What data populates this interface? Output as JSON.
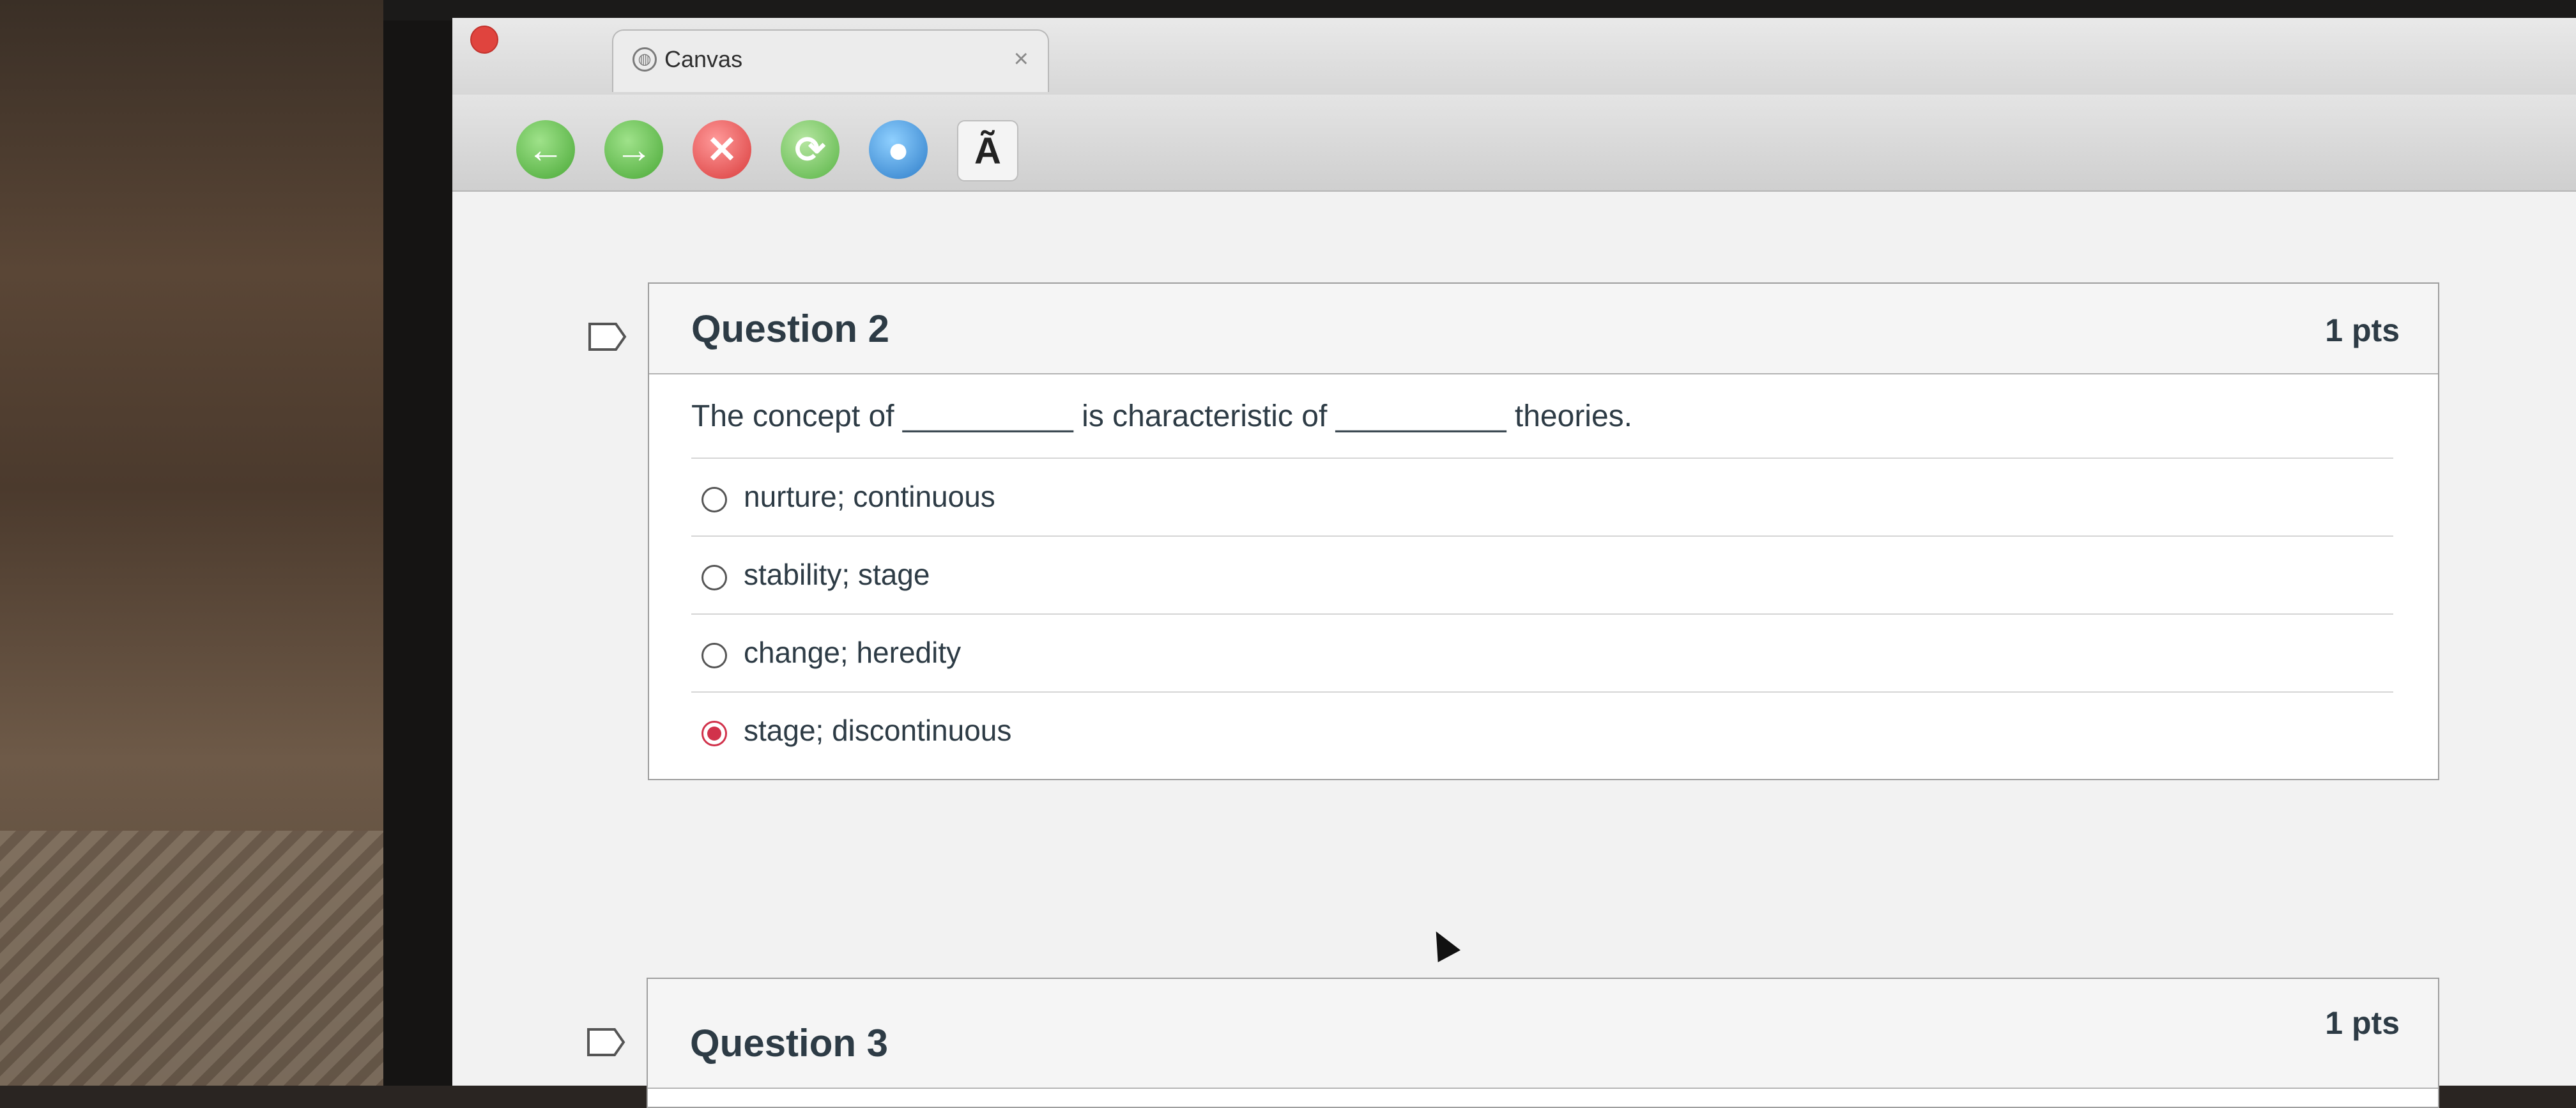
{
  "browser": {
    "tab_title": "Canvas",
    "tab_close_glyph": "×",
    "toolbar": {
      "back_icon": "back-arrow-icon",
      "forward_icon": "forward-arrow-icon",
      "stop_icon": "stop-icon",
      "reload_icon": "reload-icon",
      "home_icon": "globe-home-icon",
      "font_label": "Ã"
    }
  },
  "questions": [
    {
      "title": "Question 2",
      "points": "1 pts",
      "text": "The concept of __________ is characteristic of __________ theories.",
      "answers": [
        {
          "label": "nurture; continuous",
          "selected": false
        },
        {
          "label": "stability; stage",
          "selected": false
        },
        {
          "label": "change; heredity",
          "selected": false
        },
        {
          "label": "stage; discontinuous",
          "selected": true
        }
      ]
    },
    {
      "title": "Question 3",
      "points": "1 pts"
    }
  ],
  "colors": {
    "accent_selected": "#d1324b",
    "text": "#2d3b45"
  }
}
